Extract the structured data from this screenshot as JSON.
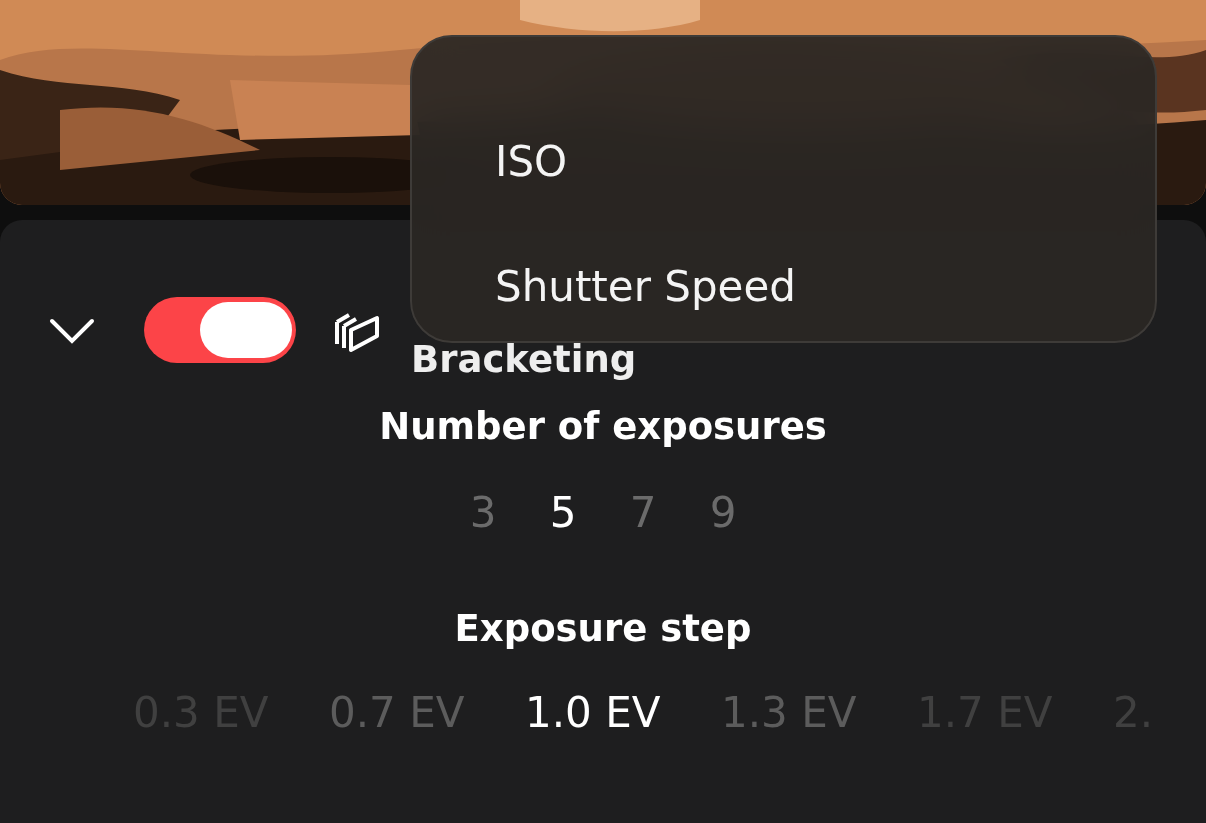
{
  "bracketing": {
    "expanded": true,
    "on": true,
    "label": "Bracketing"
  },
  "exposures": {
    "title": "Number of exposures",
    "options": [
      {
        "label": "3",
        "selected": false
      },
      {
        "label": "5",
        "selected": true
      },
      {
        "label": "7",
        "selected": false
      },
      {
        "label": "9",
        "selected": false
      }
    ]
  },
  "exposure_step": {
    "title": "Exposure step",
    "options": [
      {
        "label": "0.3 EV",
        "selected": false
      },
      {
        "label": "0.7 EV",
        "selected": false
      },
      {
        "label": "1.0 EV",
        "selected": true
      },
      {
        "label": "1.3 EV",
        "selected": false
      },
      {
        "label": "1.7 EV",
        "selected": false
      },
      {
        "label": "2.",
        "selected": false
      }
    ]
  },
  "menu": {
    "items": [
      {
        "label": "ISO"
      },
      {
        "label": "Shutter Speed"
      }
    ]
  }
}
